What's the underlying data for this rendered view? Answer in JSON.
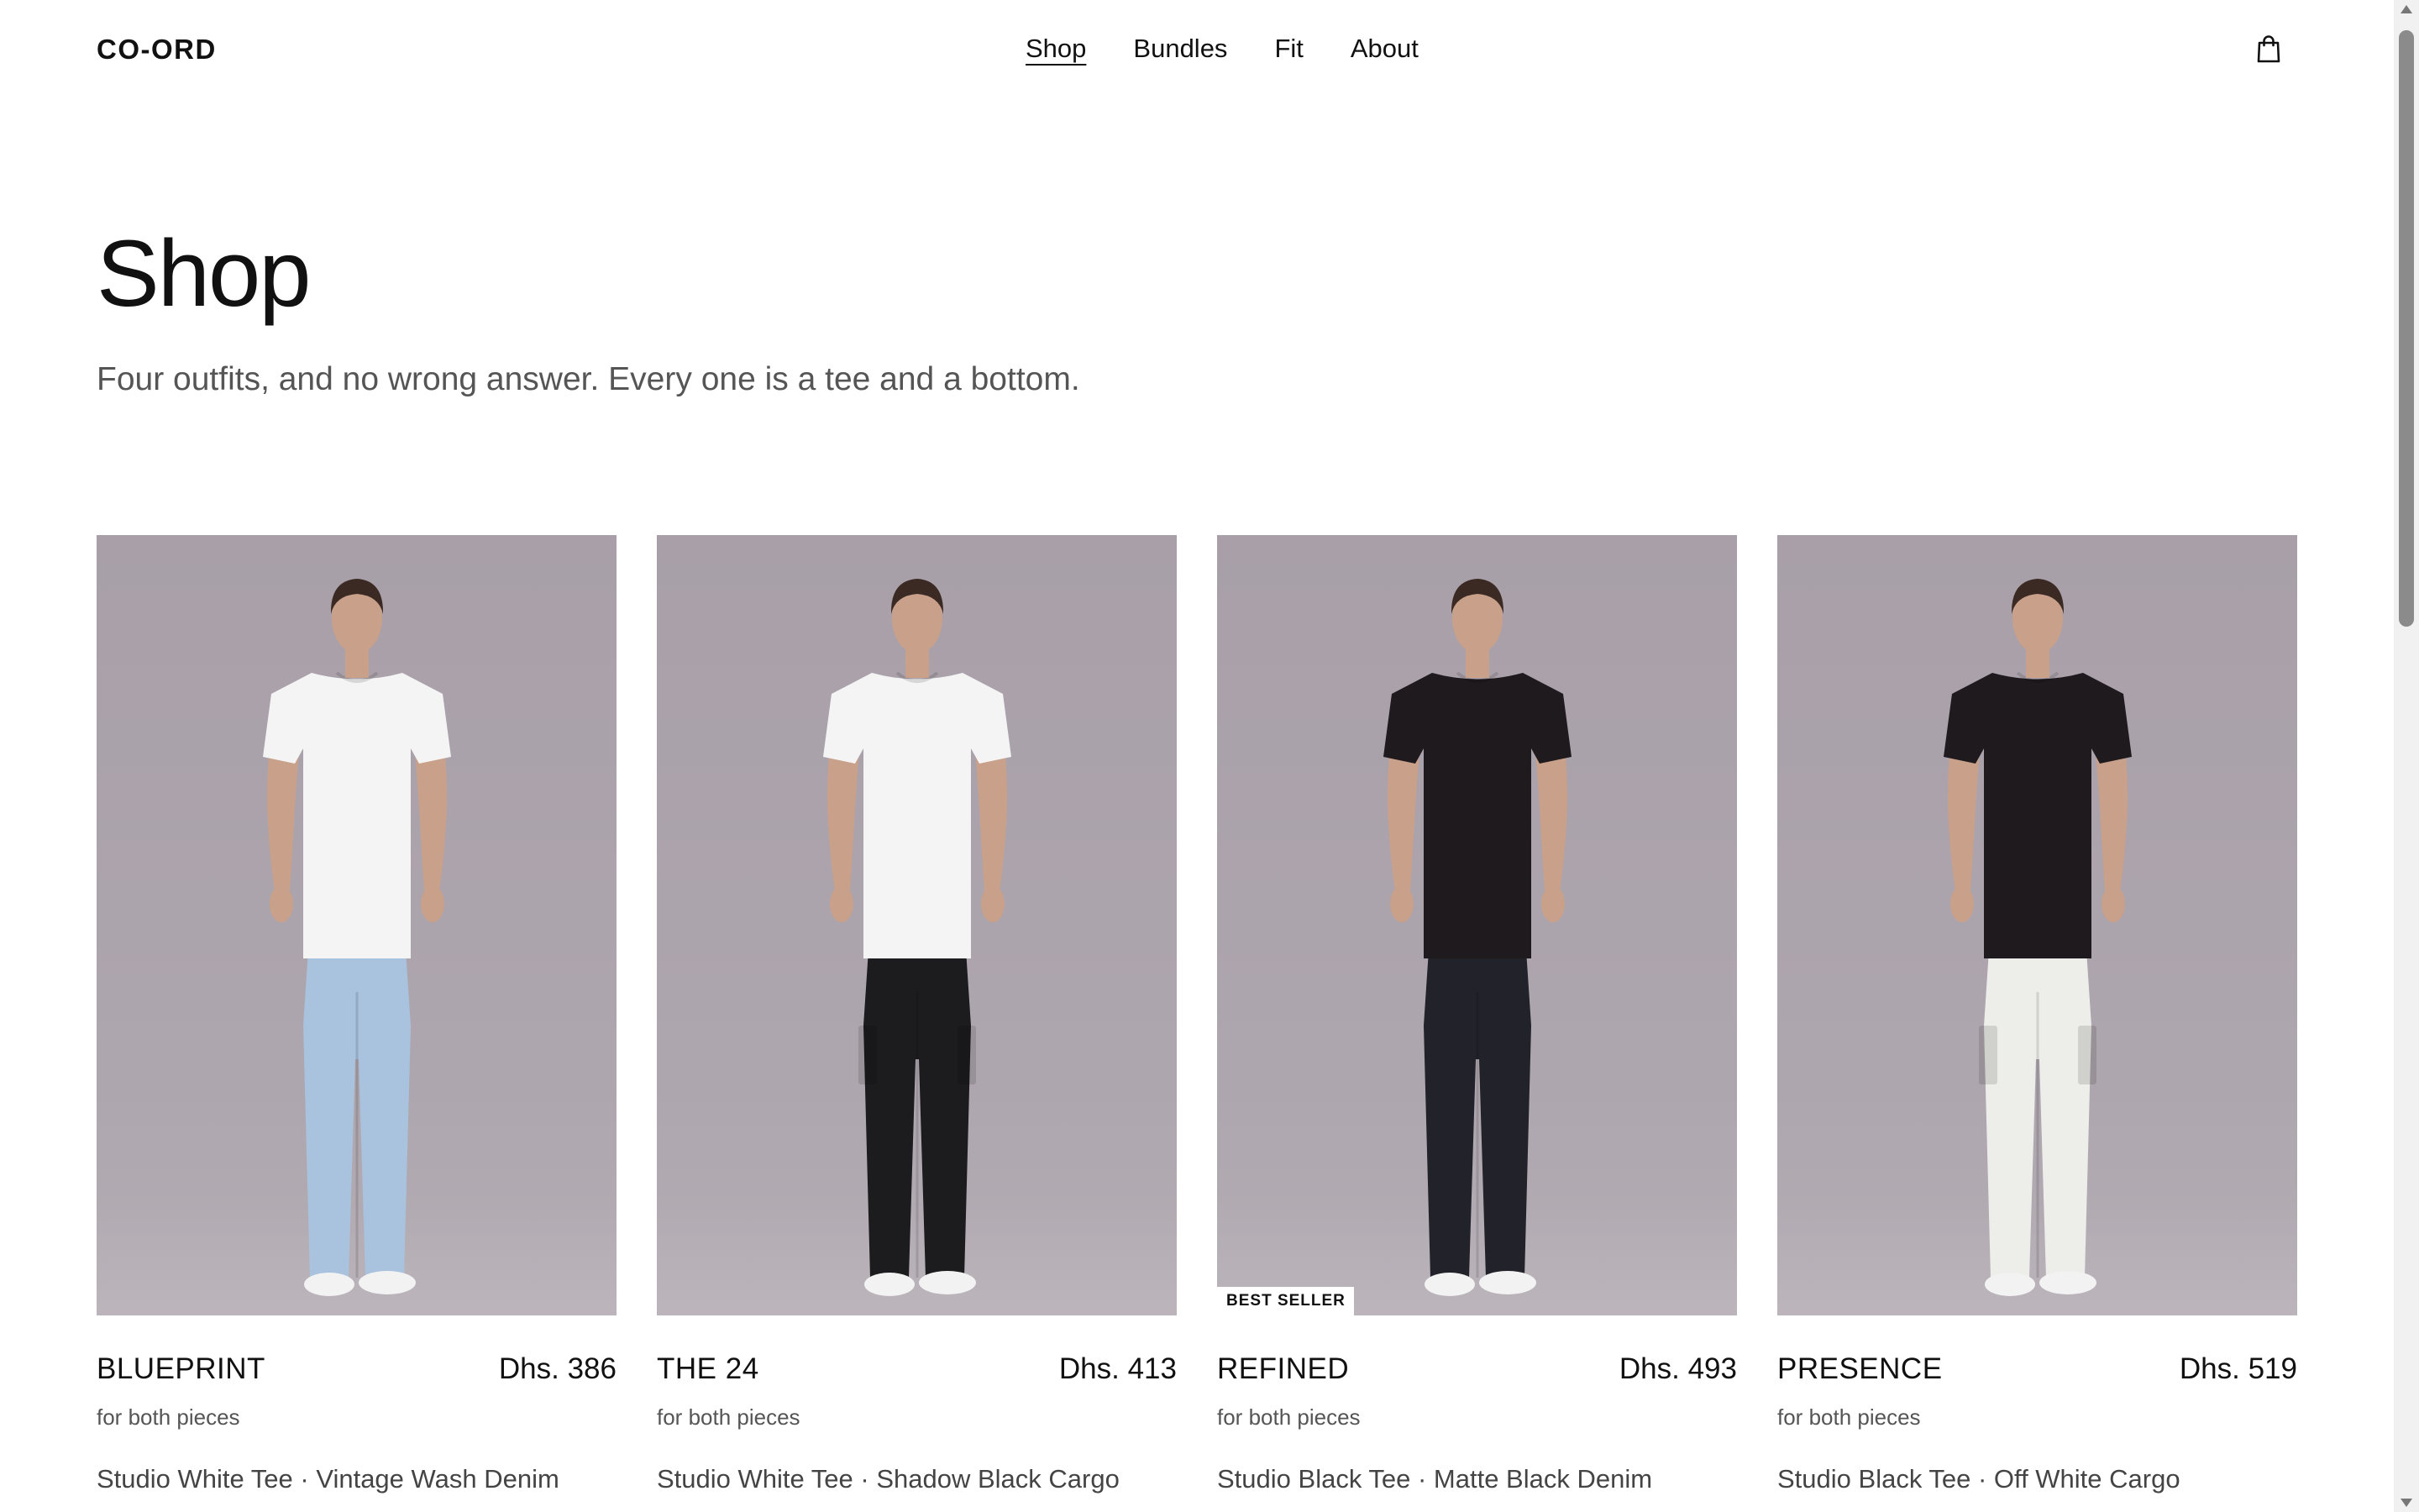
{
  "header": {
    "logo": "CO-ORD",
    "nav": [
      {
        "label": "Shop",
        "active": true
      },
      {
        "label": "Bundles",
        "active": false
      },
      {
        "label": "Fit",
        "active": false
      },
      {
        "label": "About",
        "active": false
      }
    ],
    "cart_icon": "shopping-bag-icon"
  },
  "hero": {
    "title": "Shop",
    "subtitle": "Four outfits, and no wrong answer. Every one is a tee and a bottom."
  },
  "products": [
    {
      "name": "BLUEPRINT",
      "price": "Dhs. 386",
      "note": "for both pieces",
      "items": "Studio White Tee · Vintage Wash Denim",
      "badge": "",
      "tee_color": "#f4f4f4",
      "bottom_color": "#a9c2de",
      "bottom_type": "denim"
    },
    {
      "name": "THE 24",
      "price": "Dhs. 413",
      "note": "for both pieces",
      "items": "Studio White Tee · Shadow Black Cargo",
      "badge": "",
      "tee_color": "#f4f4f4",
      "bottom_color": "#1c1b1e",
      "bottom_type": "cargo"
    },
    {
      "name": "REFINED",
      "price": "Dhs. 493",
      "note": "for both pieces",
      "items": "Studio Black Tee · Matte Black Denim",
      "badge": "BEST SELLER",
      "tee_color": "#1f1a1d",
      "bottom_color": "#22232a",
      "bottom_type": "denim"
    },
    {
      "name": "PRESENCE",
      "price": "Dhs. 519",
      "note": "for both pieces",
      "items": "Studio Black Tee · Off White Cargo",
      "badge": "",
      "tee_color": "#1f1a1d",
      "bottom_color": "#ededea",
      "bottom_type": "cargo"
    }
  ]
}
